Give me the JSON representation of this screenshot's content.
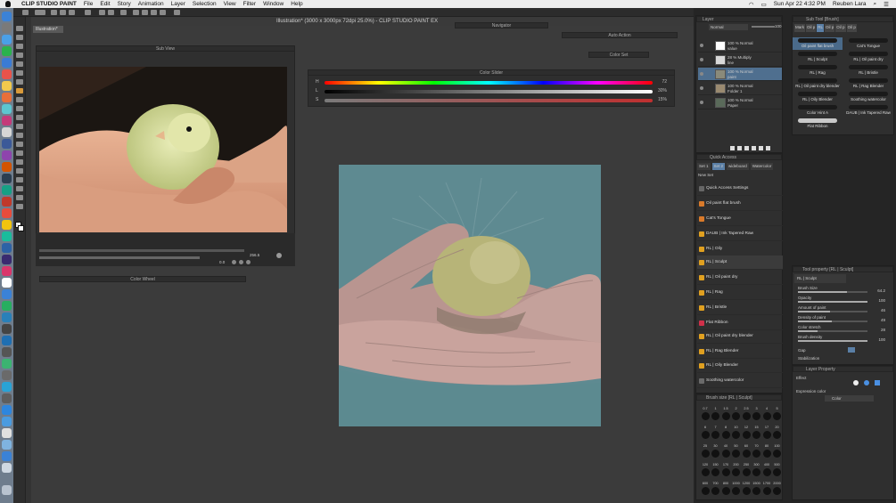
{
  "menubar": {
    "app_name": "CLIP STUDIO PAINT",
    "items": [
      "File",
      "Edit",
      "Story",
      "Animation",
      "Layer",
      "Selection",
      "View",
      "Filter",
      "Window",
      "Help"
    ],
    "clock": "Sun Apr 22  4:32 PM",
    "user": "Reuben Lara"
  },
  "window": {
    "title": "Illustration* (3000 x 3000px 72dpi 25.0%)  - CLIP STUDIO PAINT EX",
    "doc_tab": "Illustration*"
  },
  "panels": {
    "sub_view": "Sub View",
    "sub_view_zoom": "256.5",
    "sub_view_angle": "0.0",
    "color_wheel": "Color Wheel",
    "color_slider": "Color Slider",
    "navigator": "Navigator",
    "auto_action": "Auto Action",
    "color_set": "Color Set"
  },
  "color_slider": {
    "rows": [
      {
        "label": "H",
        "value": "72"
      },
      {
        "label": "L",
        "value": "30%"
      },
      {
        "label": "S",
        "value": "15%"
      }
    ]
  },
  "layers": {
    "tab": "Layer",
    "blend_mode": "Normal",
    "opacity": "100",
    "items": [
      {
        "line1": "100 % Normal",
        "line2": "value",
        "selected": false,
        "thumb": "#ffffff"
      },
      {
        "line1": "28 % Multiply",
        "line2": "line",
        "selected": false,
        "thumb": "#d9d9d9"
      },
      {
        "line1": "100 % Normal",
        "line2": "paint",
        "selected": true,
        "thumb": "#8a8a7a"
      },
      {
        "line1": "100 % Normal",
        "line2": "Folder 1",
        "selected": false,
        "thumb": "#9a8a70"
      },
      {
        "line1": "100 % Normal",
        "line2": "Paper",
        "selected": false,
        "thumb": "#5a6a5a"
      }
    ]
  },
  "sub_tool": {
    "tab": "Sub Tool [Brush]",
    "tabs": [
      "Mark",
      "Oil p",
      "RL",
      "Oil p",
      "Oil p",
      "Oil p",
      "Oil p"
    ],
    "brushes": [
      [
        "Oil paint flat brush",
        "Cat's Tongue"
      ],
      [
        "RL | Sculpt",
        "RL | Oil paint dry"
      ],
      [
        "RL | Rag",
        "RL | Bristle"
      ],
      [
        "RL | Oil paint dry blender",
        "RL | Rag Blender"
      ],
      [
        "RL | Oily Blender",
        "Soothing watercolor"
      ],
      [
        "Color Hint A",
        "DAUB | Ink Tapered Raw"
      ],
      [
        "Flat Ribbon",
        ""
      ]
    ]
  },
  "quick_access": {
    "tab": "Quick Access",
    "sets": [
      "Set 1",
      "Set 2",
      "wideboard",
      "Watercolor",
      "New Set"
    ],
    "settings_label": "Quick Access Settings",
    "items": [
      {
        "label": "Oil paint flat brush",
        "color": "#d97a2a"
      },
      {
        "label": "Cat's Tongue",
        "color": "#d97a2a"
      },
      {
        "label": "DAUB | Ink Tapered Raw",
        "color": "#e0a020"
      },
      {
        "label": "RL | Oily",
        "color": "#e0a020"
      },
      {
        "label": "RL | Sculpt",
        "color": "#e0a020"
      },
      {
        "label": "RL | Oil paint dry",
        "color": "#e0a020"
      },
      {
        "label": "RL | Rag",
        "color": "#e0a020"
      },
      {
        "label": "RL | Bristle",
        "color": "#e0a020"
      },
      {
        "label": "Flat Ribbon",
        "color": "#d0304a"
      },
      {
        "label": "RL | Oil paint dry blender",
        "color": "#e0a020"
      },
      {
        "label": "RL | Rag Blender",
        "color": "#e0a020"
      },
      {
        "label": "RL | Oily Blender",
        "color": "#e0a020"
      },
      {
        "label": "Soothing watercolor",
        "color": "#6a6a6a"
      }
    ]
  },
  "brush_size": {
    "tab": "Brush size [RL | Sculpt]",
    "sizes": [
      "0.7",
      "1",
      "1.5",
      "2",
      "2.5",
      "3",
      "4",
      "5",
      "6",
      "7",
      "8",
      "10",
      "12",
      "15",
      "17",
      "20",
      "25",
      "30",
      "40",
      "50",
      "60",
      "70",
      "80",
      "100",
      "120",
      "150",
      "170",
      "200",
      "250",
      "300",
      "400",
      "500",
      "600",
      "700",
      "800",
      "1000",
      "1200",
      "1500",
      "1700",
      "2000"
    ]
  },
  "tool_property": {
    "tab": "Tool property [RL | Sculpt]",
    "brush_name": "RL | Sculpt",
    "rows": [
      {
        "label": "Brush Size",
        "value": "64.2",
        "fill": 0.7
      },
      {
        "label": "Opacity",
        "value": "100",
        "fill": 1.0
      },
      {
        "label": "Amount of paint",
        "value": "46",
        "fill": 0.46
      },
      {
        "label": "Density of paint",
        "value": "49",
        "fill": 0.49
      },
      {
        "label": "Color stretch",
        "value": "28",
        "fill": 0.28
      },
      {
        "label": "Brush density",
        "value": "100",
        "fill": 1.0
      }
    ],
    "gap_label": "Gap",
    "stabilization_label": "Stabilization"
  },
  "layer_property": {
    "tab": "Layer Property",
    "effect_label": "Effect",
    "expression_label": "Expression color",
    "expression_value": "Color"
  }
}
